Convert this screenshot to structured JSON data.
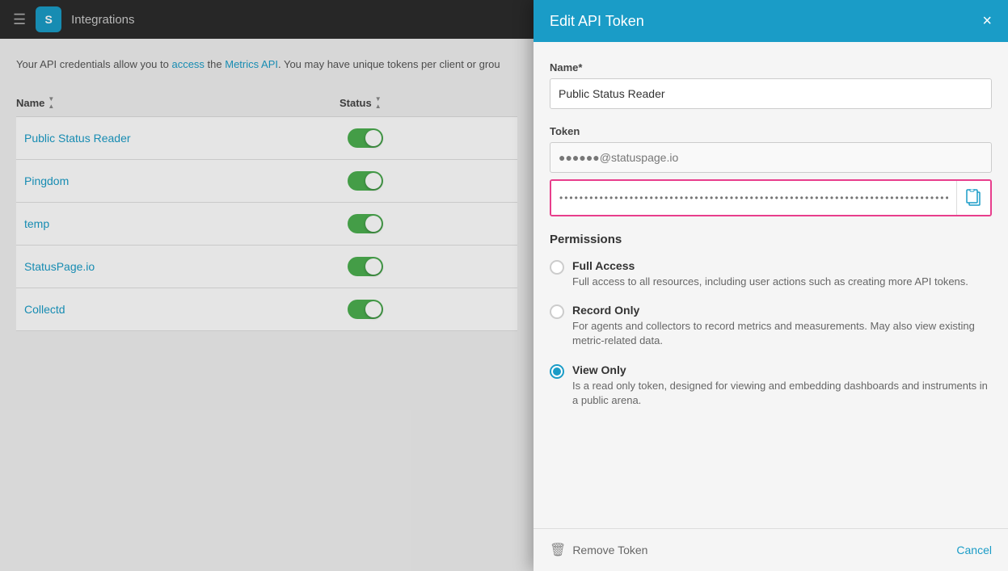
{
  "topbar": {
    "title": "Integrations",
    "logo_text": "S"
  },
  "content": {
    "info_text": "Your API credentials allow you to ",
    "info_link1": "access",
    "info_middle": " the ",
    "info_link2": "Metrics API",
    "info_end": ". You may have unique tokens per client or grou"
  },
  "table": {
    "col_name": "Name",
    "col_status": "Status",
    "rows": [
      {
        "name": "Public Status Reader",
        "status": true
      },
      {
        "name": "Pingdom",
        "status": true
      },
      {
        "name": "temp",
        "status": true
      },
      {
        "name": "StatusPage.io",
        "status": true
      },
      {
        "name": "Collectd",
        "status": true
      }
    ]
  },
  "modal": {
    "title": "Edit API Token",
    "close_label": "×",
    "name_label": "Name*",
    "name_value": "Public Status Reader",
    "token_label": "Token",
    "token_email": "●●●●●●@statuspage.io",
    "token_value_placeholder": "●●●●●●●●●●●●●●●●●●●●●●●●●●●●●●●●●●●●●●●●●●●●●●●●●●●●●●●●●●●●",
    "permissions_label": "Permissions",
    "permissions": [
      {
        "id": "full_access",
        "label": "Full Access",
        "description": "Full access to all resources, including user actions such as creating more API tokens.",
        "selected": false
      },
      {
        "id": "record_only",
        "label": "Record Only",
        "description": "For agents and collectors to record metrics and measurements. May also view existing metric-related data.",
        "selected": false
      },
      {
        "id": "view_only",
        "label": "View Only",
        "description": "Is a read only token, designed for viewing and embedding dashboards and instruments in a public arena.",
        "selected": true
      }
    ],
    "remove_token_label": "Remove Token",
    "cancel_label": "Cancel"
  },
  "colors": {
    "primary": "#1a9cc7",
    "toggle_on": "#4caf50",
    "highlight_border": "#e83e8c"
  }
}
